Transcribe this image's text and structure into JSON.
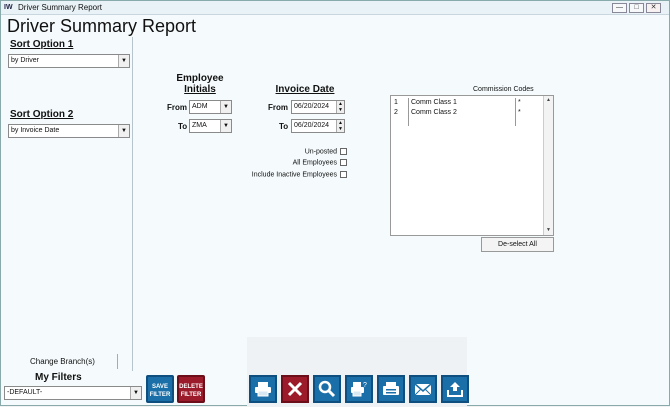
{
  "window": {
    "title": "Driver Summary Report",
    "app_icon": "app-logo-icon"
  },
  "report_title": "Driver Summary Report",
  "sort1": {
    "label": "Sort Option 1",
    "value": "by Driver"
  },
  "sort2": {
    "label": "Sort Option 2",
    "value": "by Invoice Date"
  },
  "change_branch": "Change Branch(s)",
  "employee": {
    "header_line1": "Employee",
    "header_line2": "Initials",
    "from_label": "From",
    "from_value": "ADM",
    "to_label": "To",
    "to_value": "ZMA"
  },
  "invoice": {
    "header": "Invoice Date",
    "from_label": "From",
    "from_value": "06/20/2024",
    "to_label": "To",
    "to_value": "06/20/2024"
  },
  "options": {
    "unposted": "Un-posted",
    "all_employees": "All Employees",
    "include_inactive": "Include Inactive Employees"
  },
  "commission": {
    "label": "Commission Codes",
    "rows": [
      {
        "num": "1",
        "name": "Comm Class 1",
        "flag": "*"
      },
      {
        "num": "2",
        "name": "Comm Class 2",
        "flag": "*"
      }
    ],
    "deselect_all": "De-select All"
  },
  "filters": {
    "label": "My Filters",
    "value": "-DEFAULT-",
    "save_line1": "SAVE",
    "save_line2": "FILTER",
    "delete_line1": "DELETE",
    "delete_line2": "FILTER"
  },
  "colors": {
    "save": "#1b6fa8",
    "delete": "#9b1b2a",
    "toolbar": "#1b6fa8"
  }
}
